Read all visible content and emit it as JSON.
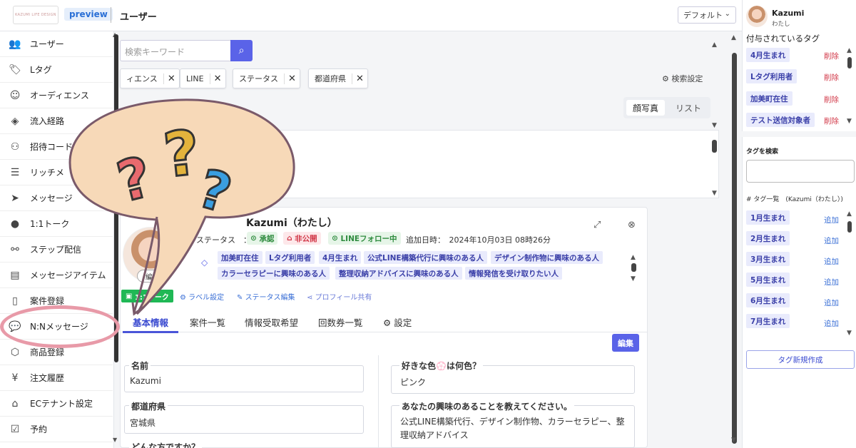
{
  "header": {
    "logo_text": "KAZUMI LIFE DESIGN",
    "preview_label": "preview",
    "page_title": "ユーザー",
    "view_select": "デフォルト"
  },
  "sidebar": {
    "items": [
      {
        "label": "ユーザー",
        "icon": "users-icon"
      },
      {
        "label": "Lタグ",
        "icon": "tag-icon"
      },
      {
        "label": "オーディエンス",
        "icon": "smile-icon"
      },
      {
        "label": "流入経路",
        "icon": "route-icon"
      },
      {
        "label": "招待コード",
        "icon": "invite-icon"
      },
      {
        "label": "リッチメ",
        "icon": "richmenu-icon"
      },
      {
        "label": "メッセージ",
        "icon": "send-icon"
      },
      {
        "label": "1:1トーク",
        "icon": "line-icon"
      },
      {
        "label": "ステップ配信",
        "icon": "step-icon"
      },
      {
        "label": "メッセージアイテム",
        "icon": "message-item-icon"
      },
      {
        "label": "案件登録",
        "icon": "document-icon"
      },
      {
        "label": "N:Nメッセージ",
        "icon": "chat-bubble-icon"
      },
      {
        "label": "商品登録",
        "icon": "box-icon"
      },
      {
        "label": "注文履歴",
        "icon": "yen-icon"
      },
      {
        "label": "ECテナント設定",
        "icon": "store-icon"
      },
      {
        "label": "予約",
        "icon": "calendar-icon"
      }
    ]
  },
  "search": {
    "placeholder": "検索キーワード"
  },
  "filters": [
    {
      "label": "ィエンス"
    },
    {
      "label": "LINE"
    },
    {
      "label": "ステータス"
    },
    {
      "label": "都道府県"
    }
  ],
  "search_settings": "検索設定",
  "view_toggle": {
    "option1": "顔写真",
    "option2": "リスト"
  },
  "profile": {
    "name": "Kazumi（わたし）",
    "status_label": "ステータス　：",
    "badges": [
      "承認",
      "非公開",
      "LINEフォロー中"
    ],
    "added_label": "追加日時：　2024年10月03日 08時26分",
    "edit_avatar": "編集",
    "tags": [
      "加美町在住",
      "Lタグ利用者",
      "4月生まれ",
      "公式LINE構築代行に興味のある人",
      "デザイン制作物に興味のある人",
      "カラーセラピーに興味のある人",
      "整理収納アドバイスに興味のある人",
      "情報発信を受け取りたい人"
    ],
    "actions": {
      "talk": "1:1トーク",
      "label_settings": "ラベル設定",
      "status_edit": "ステータス編集",
      "share": "プロフィール共有"
    },
    "tabs": [
      "基本情報",
      "案件一覧",
      "情報受取希望",
      "回数券一覧",
      "設定"
    ],
    "edit_button": "編集",
    "fields": {
      "name_label": "名前",
      "name_value": "Kazumi",
      "pref_label": "都道府県",
      "pref_value": "宮城県",
      "who_label": "どんな方ですか？",
      "color_label": "好きな色💮は何色？",
      "color_value": "ピンク",
      "interest_label": "あなたの興味のあることを教えてください。",
      "interest_value": "公式LINE構築代行、デザイン制作物、カラーセラピー、整理収納アドバイス"
    }
  },
  "right_panel": {
    "user_name": "Kazumi",
    "user_sub": "わたし",
    "assigned_header": "付与されているタグ",
    "assigned_tags": [
      "4月生まれ",
      "Lタグ利用者",
      "加美町在住",
      "テスト送信対象者"
    ],
    "delete_label": "削除",
    "tag_search_header": "タグを検索",
    "tag_list_header": "# タグ一覧　(Kazumi（わたし）)",
    "available_tags": [
      "1月生まれ",
      "2月生まれ",
      "3月生まれ",
      "5月生まれ",
      "6月生まれ",
      "7月生まれ"
    ],
    "add_label": "追加",
    "new_tag_button": "タグ新規作成"
  },
  "colors": {
    "accent": "#5a63e8",
    "tag_bg": "#e9ebfc",
    "line_green": "#1fb855",
    "delete_red": "#d23a4a",
    "balloon_fill": "#f7d9b8",
    "ring": "#e89aa8"
  }
}
